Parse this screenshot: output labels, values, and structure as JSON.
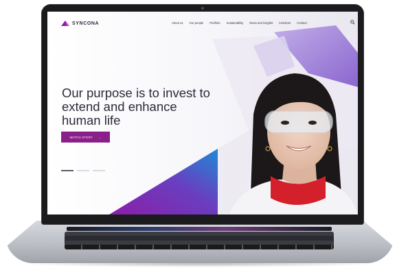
{
  "brand": {
    "name": "SYNCONA"
  },
  "nav": {
    "items": [
      {
        "label": "About us"
      },
      {
        "label": "Our people"
      },
      {
        "label": "Portfolio"
      },
      {
        "label": "Sustainability"
      },
      {
        "label": "News and insights"
      },
      {
        "label": "Investors"
      },
      {
        "label": "Contact"
      }
    ],
    "search_icon": "search-icon"
  },
  "hero": {
    "headline": "Our purpose is to invest to extend and enhance human life",
    "cta_label": "WATCH STORY",
    "cta_arrow": "→",
    "slides_total": 3,
    "slide_active": 1
  },
  "colors": {
    "accent": "#8a1e8a",
    "headline": "#2b2b3a",
    "gradient_start": "#7a1fa0",
    "gradient_end": "#1e78c8"
  }
}
